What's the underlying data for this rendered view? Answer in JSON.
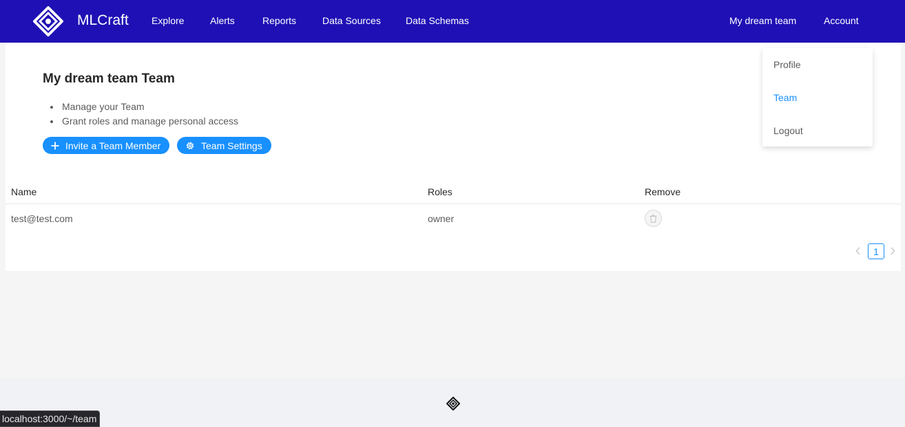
{
  "header": {
    "brand": "MLCraft",
    "nav": [
      "Explore",
      "Alerts",
      "Reports",
      "Data Sources",
      "Data Schemas"
    ],
    "team_link": "My dream team",
    "account_link": "Account"
  },
  "page": {
    "title": "My dream team Team",
    "bullets": [
      "Manage your Team",
      "Grant roles and manage personal access"
    ],
    "invite_button": "Invite a Team Member",
    "settings_button": "Team Settings"
  },
  "table": {
    "columns": [
      "Name",
      "Roles",
      "Remove"
    ],
    "rows": [
      {
        "name": "test@test.com",
        "role": "owner"
      }
    ]
  },
  "pagination": {
    "current": "1"
  },
  "account_menu": {
    "items": [
      "Profile",
      "Team",
      "Logout"
    ],
    "active": "Team"
  },
  "status_url": "localhost:3000/~/team",
  "colors": {
    "header_bg": "#1f10b5",
    "primary": "#1890ff",
    "page_bg": "#f5f5f5"
  },
  "icons": {
    "logo": "mlcraft-logo-icon",
    "invite": "plus-icon",
    "settings": "gear-icon",
    "remove": "trash-icon",
    "prev": "chevron-left-icon",
    "next": "chevron-right-icon"
  }
}
